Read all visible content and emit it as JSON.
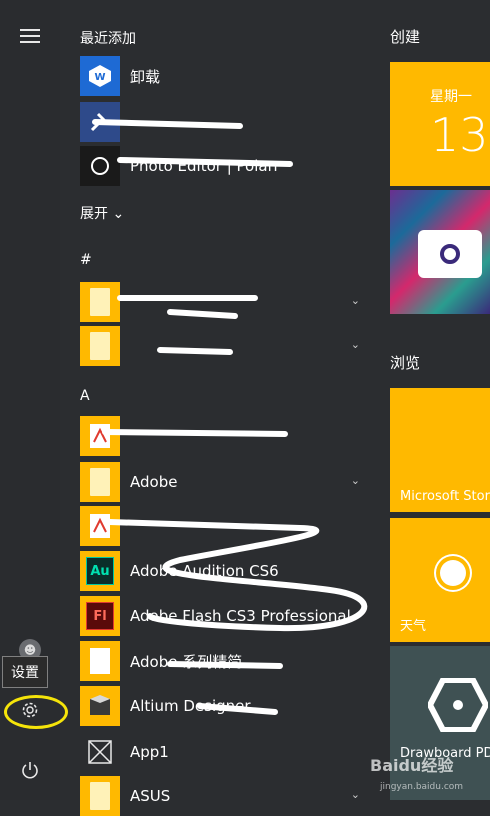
{
  "left_rail": {
    "tooltip": "设置",
    "icons": [
      "hamburger-icon",
      "user-icon",
      "settings-gear-icon",
      "power-icon"
    ]
  },
  "sections": {
    "recent": "最近添加",
    "expand": "展开",
    "hash": "#",
    "a": "A"
  },
  "apps": [
    {
      "label": "卸载",
      "icon": "wps-icon",
      "tile_color": "#1e6ad4"
    },
    {
      "label": "",
      "icon": "tools-icon",
      "tile_color": "#2e4a8a"
    },
    {
      "label": "Photo Editor | Polarr",
      "icon": "polarr-icon",
      "tile_color": "#1a1a1a"
    },
    {
      "label": "",
      "icon": "folder-icon",
      "tile_color": "#ffb900",
      "expandable": true
    },
    {
      "label": "",
      "icon": "folder-icon",
      "tile_color": "#ffb900",
      "expandable": true
    },
    {
      "label": "",
      "icon": "acrobat-distiller-icon",
      "tile_color": "#ffb900"
    },
    {
      "label": "Adobe",
      "icon": "folder-icon",
      "tile_color": "#ffb900",
      "expandable": true
    },
    {
      "label": "",
      "icon": "acrobat-icon",
      "tile_color": "#ffb900"
    },
    {
      "label": "Adobe Audition CS6",
      "icon": "audition-icon",
      "tile_color": "#ffb900"
    },
    {
      "label": "Adobe Flash CS3 Professional",
      "icon": "flash-icon",
      "tile_color": "#ffb900"
    },
    {
      "label": "Adobe 系列精简",
      "icon": "document-icon",
      "tile_color": "#ffb900"
    },
    {
      "label": "Altium Designer",
      "icon": "altium-icon",
      "tile_color": "#ffb900"
    },
    {
      "label": "App1",
      "icon": "app1-icon",
      "tile_color": "#2b2d30"
    },
    {
      "label": "ASUS",
      "icon": "folder-icon",
      "tile_color": "#ffb900",
      "expandable": true
    }
  ],
  "groups": {
    "create": "创建",
    "browse": "浏览"
  },
  "tiles": {
    "calendar_day": "星期一",
    "calendar_date": "13",
    "store": "Microsoft Store",
    "weather": "天气",
    "drawboard": "Drawboard PDF"
  },
  "watermark": {
    "brand": "Baidu经验",
    "url": "jingyan.baidu.com"
  },
  "colors": {
    "accent": "#ffb900",
    "background": "#2b2d30",
    "highlight": "#f5e40a"
  }
}
